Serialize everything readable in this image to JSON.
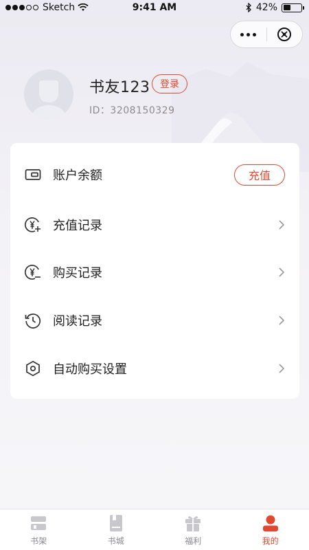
{
  "status_bar": {
    "carrier": "Sketch",
    "time": "9:41 AM",
    "battery_text": "42%",
    "battery_level": 0.42
  },
  "capsule": {
    "more_icon": "more-dots-icon",
    "close_icon": "close-circle-icon"
  },
  "profile": {
    "username": "书友123",
    "login_label": "登录",
    "user_id": "ID：3208150329"
  },
  "menu": {
    "items": [
      {
        "label": "账户余额",
        "icon": "wallet-icon",
        "action_label": "充值"
      },
      {
        "label": "充值记录",
        "icon": "yuan-plus-icon"
      },
      {
        "label": "购买记录",
        "icon": "yuan-minus-icon"
      },
      {
        "label": "阅读记录",
        "icon": "history-icon"
      },
      {
        "label": "自动购买设置",
        "icon": "hexagon-settings-icon"
      }
    ]
  },
  "tab_bar": {
    "tabs": [
      {
        "label": "书架",
        "icon": "bookshelf-icon",
        "active": false
      },
      {
        "label": "书城",
        "icon": "bookstore-icon",
        "active": false
      },
      {
        "label": "福利",
        "icon": "gift-icon",
        "active": false
      },
      {
        "label": "我的",
        "icon": "profile-icon",
        "active": true
      }
    ]
  },
  "colors": {
    "accent": "#e0492f",
    "inactive": "#c7c7cc",
    "background": "#f2f2f6"
  }
}
